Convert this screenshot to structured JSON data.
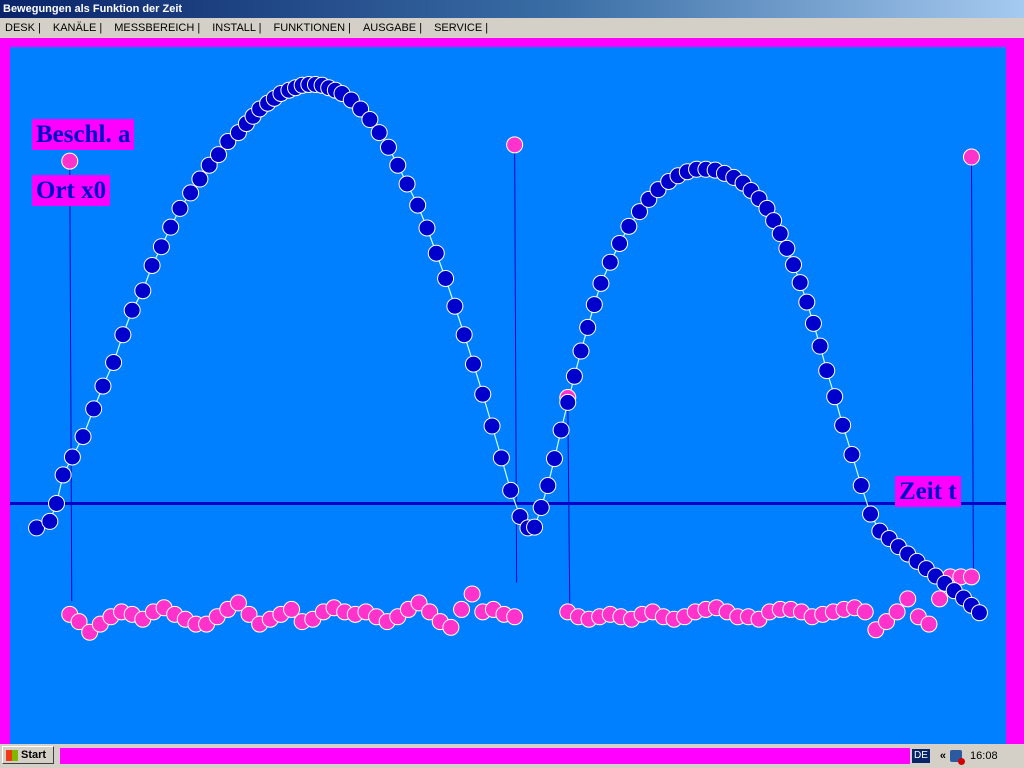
{
  "window": {
    "title": "Bewegungen als Funktion der Zeit"
  },
  "menu": {
    "items": [
      "DESK |",
      "KANÄLE |",
      "MESSBEREICH |",
      "INSTALL |",
      "FUNKTIONEN |",
      "AUSGABE |",
      "SERVICE |"
    ]
  },
  "labels": {
    "accel": "Beschl. a",
    "position": "Ort x0",
    "time": "Zeit t"
  },
  "colors": {
    "plot_background": "#0080FF",
    "frame": "#FF00FF",
    "position_points": "#0000CC",
    "acceleration_points": "#FF33CC",
    "axis_line": "#0000CC",
    "fit_curve": "#CCFFFF"
  },
  "taskbar": {
    "start_label": "Start",
    "language": "DE",
    "clock": "16:08",
    "tray_icons": [
      "chevron-icon",
      "network-error-icon"
    ]
  },
  "chart_data": {
    "type": "scatter",
    "title": "",
    "xlabel": "Zeit t",
    "ylabel": "",
    "axis_y": 0,
    "series": [
      {
        "name": "Ort x0",
        "marker": "circle",
        "x": [
          0.0,
          0.1,
          0.15,
          0.2,
          0.27,
          0.35,
          0.43,
          0.5,
          0.58,
          0.65,
          0.72,
          0.8,
          0.87,
          0.94,
          1.01,
          1.08,
          1.16,
          1.23,
          1.3,
          1.37,
          1.44,
          1.52,
          1.58,
          1.63,
          1.68,
          1.74,
          1.79,
          1.84,
          1.9,
          1.95,
          2.0,
          2.05,
          2.1,
          2.15,
          2.2,
          2.25,
          2.3,
          2.37,
          2.44,
          2.51,
          2.58,
          2.65,
          2.72,
          2.79,
          2.87,
          2.94,
          3.01,
          3.08,
          3.15,
          3.22,
          3.29,
          3.36,
          3.43,
          3.5,
          3.57,
          3.64,
          3.7,
          3.75,
          3.8,
          3.85,
          3.9,
          3.95,
          4.0,
          4.05,
          4.1,
          4.15,
          4.2,
          4.25,
          4.32,
          4.39,
          4.46,
          4.54,
          4.61,
          4.68,
          4.76,
          4.83,
          4.9,
          4.97,
          5.04,
          5.11,
          5.18,
          5.25,
          5.32,
          5.38,
          5.44,
          5.5,
          5.55,
          5.6,
          5.65,
          5.7,
          5.75,
          5.8,
          5.85,
          5.9,
          5.95,
          6.01,
          6.07,
          6.14,
          6.21,
          6.28,
          6.35,
          6.42,
          6.49,
          6.56,
          6.63,
          6.7,
          6.77,
          6.84,
          6.91,
          6.98,
          7.04,
          7.1
        ],
        "y": [
          -0.3,
          -0.22,
          0.0,
          0.35,
          0.57,
          0.82,
          1.16,
          1.44,
          1.73,
          2.07,
          2.37,
          2.61,
          2.92,
          3.15,
          3.39,
          3.62,
          3.81,
          3.98,
          4.15,
          4.28,
          4.44,
          4.55,
          4.66,
          4.75,
          4.84,
          4.91,
          4.97,
          5.03,
          5.07,
          5.1,
          5.13,
          5.14,
          5.14,
          5.13,
          5.1,
          5.07,
          5.03,
          4.95,
          4.84,
          4.71,
          4.55,
          4.37,
          4.15,
          3.92,
          3.66,
          3.38,
          3.07,
          2.76,
          2.42,
          2.07,
          1.71,
          1.34,
          0.95,
          0.56,
          0.16,
          -0.16,
          -0.3,
          -0.29,
          -0.05,
          0.22,
          0.55,
          0.9,
          1.24,
          1.56,
          1.87,
          2.16,
          2.44,
          2.7,
          2.96,
          3.19,
          3.4,
          3.58,
          3.73,
          3.85,
          3.95,
          4.02,
          4.07,
          4.1,
          4.1,
          4.09,
          4.05,
          4.0,
          3.93,
          3.84,
          3.74,
          3.62,
          3.47,
          3.31,
          3.13,
          2.93,
          2.71,
          2.47,
          2.21,
          1.93,
          1.63,
          1.31,
          0.96,
          0.6,
          0.22,
          -0.13,
          -0.34,
          -0.43,
          -0.53,
          -0.62,
          -0.71,
          -0.8,
          -0.89,
          -0.98,
          -1.07,
          -1.16,
          -1.25,
          -1.34
        ]
      },
      {
        "name": "Beschl. a",
        "marker": "circle",
        "x": [
          0.25,
          0.32,
          0.4,
          0.48,
          0.56,
          0.64,
          0.72,
          0.8,
          0.88,
          0.96,
          1.04,
          1.12,
          1.2,
          1.28,
          1.36,
          1.44,
          1.52,
          1.6,
          1.68,
          1.76,
          1.84,
          1.92,
          2.0,
          2.08,
          2.16,
          2.24,
          2.32,
          2.4,
          2.48,
          2.56,
          2.64,
          2.72,
          2.8,
          2.88,
          2.96,
          3.04,
          3.12,
          3.2,
          3.28,
          3.36,
          3.44,
          3.52,
          3.6,
          4.0,
          4.08,
          4.16,
          4.24,
          4.32,
          4.4,
          4.48,
          4.56,
          4.64,
          4.72,
          4.8,
          4.88,
          4.96,
          5.04,
          5.12,
          5.2,
          5.28,
          5.36,
          5.44,
          5.52,
          5.6,
          5.68,
          5.76,
          5.84,
          5.92,
          6.0,
          6.08,
          6.16,
          6.24,
          6.32,
          6.4,
          6.48,
          6.56,
          6.64,
          6.72,
          6.8,
          6.88,
          6.96,
          7.04
        ],
        "y": [
          -1.36,
          -1.45,
          -1.58,
          -1.48,
          -1.39,
          -1.33,
          -1.36,
          -1.42,
          -1.33,
          -1.28,
          -1.36,
          -1.42,
          -1.48,
          -1.48,
          -1.39,
          -1.3,
          -1.22,
          -1.36,
          -1.48,
          -1.42,
          -1.36,
          -1.3,
          -1.45,
          -1.42,
          -1.33,
          -1.28,
          -1.33,
          -1.36,
          -1.33,
          -1.39,
          -1.45,
          -1.39,
          -1.3,
          -1.22,
          -1.33,
          -1.45,
          -1.52,
          -1.3,
          -1.11,
          -1.33,
          -1.3,
          -1.36,
          -1.39,
          -1.33,
          -1.39,
          -1.42,
          -1.39,
          -1.36,
          -1.39,
          -1.42,
          -1.36,
          -1.33,
          -1.39,
          -1.42,
          -1.39,
          -1.33,
          -1.3,
          -1.28,
          -1.33,
          -1.39,
          -1.39,
          -1.42,
          -1.33,
          -1.3,
          -1.3,
          -1.33,
          -1.39,
          -1.36,
          -1.33,
          -1.3,
          -1.28,
          -1.33,
          -1.55,
          -1.45,
          -1.33,
          -1.17,
          -1.39,
          -1.48,
          -1.17,
          -0.9,
          -0.9,
          -0.9
        ]
      }
    ],
    "xlim": [
      -0.2,
      7.3
    ],
    "ylim": [
      -3.0,
      5.6
    ],
    "grid": false,
    "legend": "left"
  }
}
